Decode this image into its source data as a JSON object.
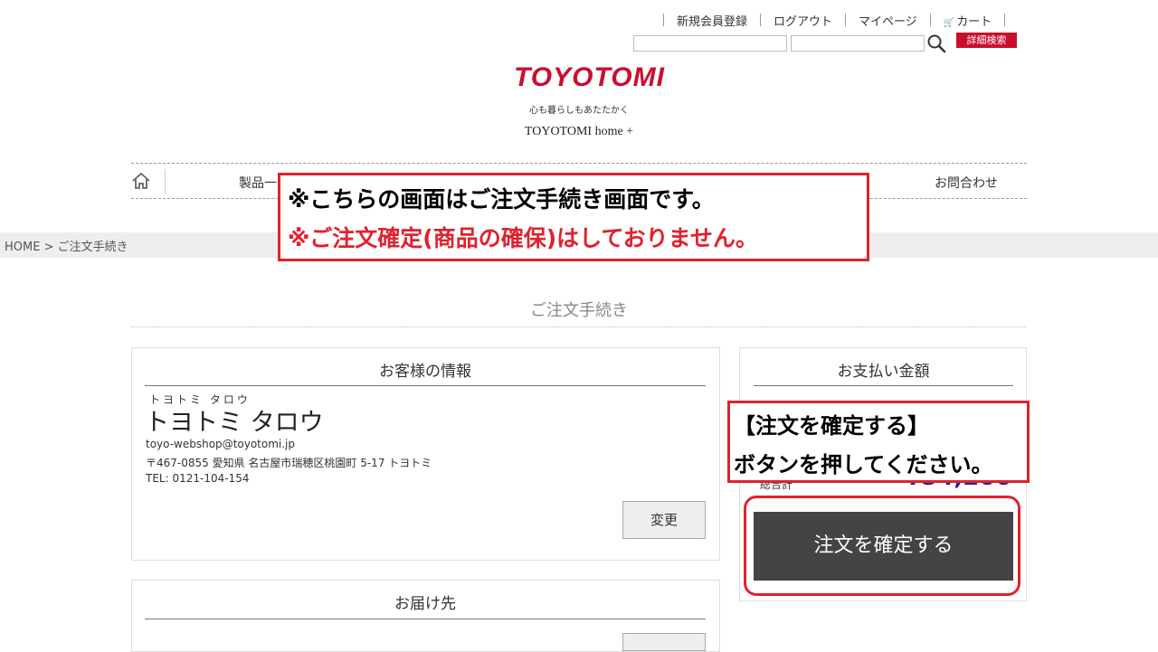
{
  "header": {
    "links": [
      "新規会員登録",
      "ログアウト",
      "マイページ",
      "カート"
    ],
    "search_placeholder": "",
    "keyword_placeholder": "",
    "advanced_search_label": "詳細検索",
    "logo_text": "TOYOTOMI",
    "tagline": "心も暮らしもあたたかく",
    "brand_sub": "TOYOTOMI home +"
  },
  "nav": {
    "items": [
      "製品一",
      "お問合わせ"
    ]
  },
  "breadcrumb": "HOME > ご注文手続き",
  "notice": {
    "line1": "※こちらの画面はご注文手続き画面です。",
    "line2": "※ご注文確定(商品の確保)はしておりません。"
  },
  "page_title": "ご注文手続き",
  "customer": {
    "heading": "お客様の情報",
    "furigana": "トヨトミ タロウ",
    "name": "トヨトミ タロウ",
    "email": "toyo-webshop@toyotomi.jp",
    "address": "〒467-0855 愛知県 名古屋市瑞穂区桃園町 5-17 トヨトミ",
    "tel": "TEL: 0121-104-154",
    "change_label": "変更"
  },
  "delivery": {
    "heading": "お届け先"
  },
  "payment": {
    "heading": "お支払い金額",
    "total_label": "総合計",
    "total_amount": "¥54,200",
    "confirm_label": "注文を確定する"
  },
  "instruction": {
    "line1": "【注文を確定する】",
    "line2": "ボタンを押してください。"
  },
  "colors": {
    "accent_red": "#c8102e",
    "notice_red": "#e0222e",
    "total_blue": "#1a2a9a",
    "button_dark": "#444444"
  }
}
